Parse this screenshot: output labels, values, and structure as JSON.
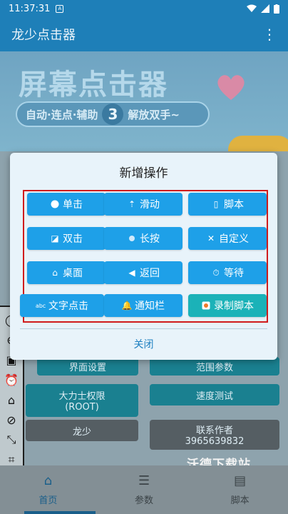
{
  "status_bar": {
    "time": "11:37:31",
    "notif": "A"
  },
  "app_bar": {
    "title": "龙少点击器",
    "menu_icon": "more-vert-icon"
  },
  "banner": {
    "headline": "屏幕点击器",
    "tagline_a": "自动·连点·辅助",
    "tagline_num": "3",
    "tagline_b": "解放双手~"
  },
  "background": {
    "buttons": [
      {
        "label": "界面设置"
      },
      {
        "label": "范围参数"
      },
      {
        "label": "大力士权限",
        "sub": "(ROOT)"
      },
      {
        "label": "速度测试"
      },
      {
        "label": "龙少"
      },
      {
        "label": "联系作者",
        "sub": "3965639832"
      }
    ]
  },
  "dialog": {
    "title": "新增操作",
    "close": "关闭",
    "ops": [
      {
        "label": "单击",
        "icon": "circle-icon"
      },
      {
        "label": "滑动",
        "icon": "swipe-up-icon"
      },
      {
        "label": "脚本",
        "icon": "script-scroll-icon"
      },
      {
        "label": "双击",
        "icon": "double-tap-icon"
      },
      {
        "label": "长按",
        "icon": "dot-icon"
      },
      {
        "label": "自定义",
        "icon": "tools-icon"
      },
      {
        "label": "桌面",
        "icon": "home-icon"
      },
      {
        "label": "返回",
        "icon": "back-arrow-icon"
      },
      {
        "label": "等待",
        "icon": "alarm-clock-icon"
      },
      {
        "label": "文字点击",
        "icon": "abc-icon"
      },
      {
        "label": "通知栏",
        "icon": "bell-icon"
      },
      {
        "label": "录制脚本",
        "icon": "record-icon"
      }
    ]
  },
  "bottom_nav": {
    "items": [
      {
        "label": "首页"
      },
      {
        "label": "参数"
      },
      {
        "label": "脚本"
      }
    ]
  },
  "watermark": "沃德下载站",
  "colors": {
    "primary": "#1e7fb8",
    "op_button": "#1ea0e8",
    "op_button_alt": "#1bb2b8",
    "highlight": "#d01c1c"
  }
}
